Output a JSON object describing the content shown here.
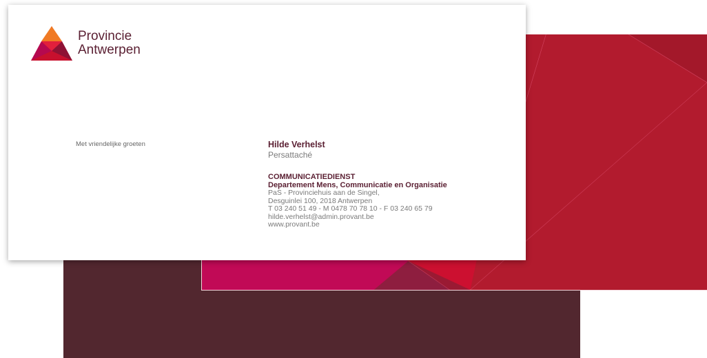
{
  "brand": {
    "line1": "Provincie",
    "line2": "Antwerpen",
    "colors": {
      "primary": "#5a1f32",
      "back": "#52272f",
      "red": "#c8102e",
      "magenta": "#b5094f",
      "orange": "#f07a24"
    }
  },
  "card": {
    "closing": "Met vriendelijke groeten",
    "name": "Hilde Verhelst",
    "role": "Persattaché",
    "department": "COMMUNICATIEDIENST",
    "subdepartment": "Departement Mens, Communicatie en Organisatie",
    "address_line1": "PaS - Provinciehuis aan de Singel,",
    "address_line2": "Desguinlei 100, 2018 Antwerpen",
    "phones": "T 03 240 51 49 - M 0478 70 78 10 - F 03 240 65 79",
    "email": "hilde.verhelst@admin.provant.be",
    "website": "www.provant.be"
  }
}
